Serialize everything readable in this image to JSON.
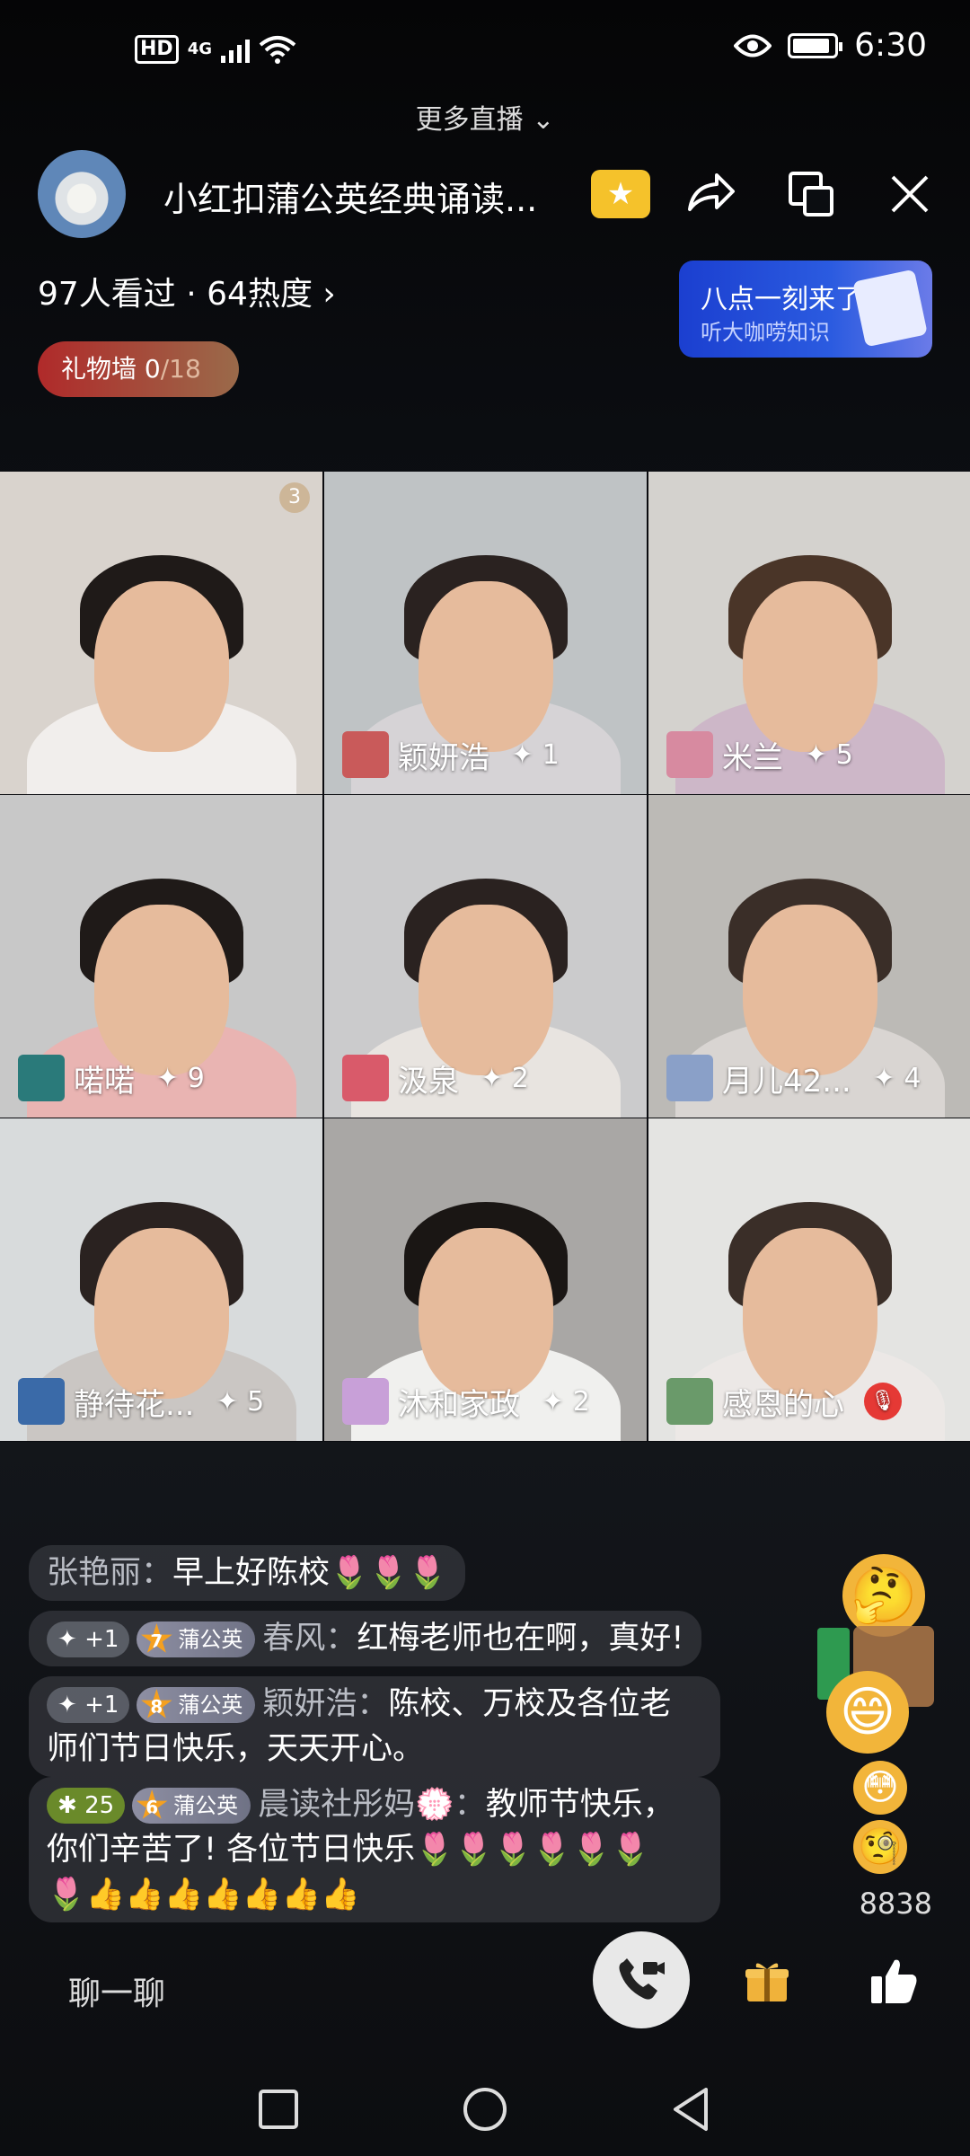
{
  "status_bar": {
    "left": {
      "hd": "HD",
      "network": "4G"
    },
    "time": "6:30"
  },
  "more_live": "更多直播",
  "header": {
    "title": "小红扣蒲公英经典诵读...",
    "icons": [
      "star-badge-icon",
      "share-icon",
      "floating-window-icon",
      "close-icon"
    ]
  },
  "stats": "97人看过 · 64热度",
  "promo": {
    "line1": "八点一刻来了",
    "line2": "听大咖唠知识"
  },
  "gift_wall": {
    "label": "礼物墙 ",
    "count": "0",
    "total": "/18"
  },
  "tiles": [
    {
      "name": "",
      "score": "",
      "count_badge": "3",
      "bg": "#d9d3cd",
      "shirt": "#f1eeec",
      "hair": "#1f1a18"
    },
    {
      "name": "颖妍浩",
      "score": "1",
      "bg": "#bfc3c5",
      "shirt": "#d6d3d6",
      "hair": "#2a2220"
    },
    {
      "name": "米兰",
      "score": "5",
      "bg": "#d4d2ce",
      "shirt": "#cdb7c8",
      "hair": "#4a3528"
    },
    {
      "name": "喏喏",
      "score": "9",
      "bg": "#c8c8c8",
      "shirt": "#e9b4b2",
      "hair": "#1f1a18"
    },
    {
      "name": "汲泉",
      "score": "2",
      "bg": "#cbcbcc",
      "shirt": "#e8e4e0",
      "hair": "#2a2220"
    },
    {
      "name": "月儿42...",
      "score": "4",
      "bg": "#bcbab6",
      "shirt": "#d9d5d2",
      "hair": "#3a2e28"
    },
    {
      "name": "静待花...",
      "score": "5",
      "bg": "#d8dbdc",
      "shirt": "#cac6c3",
      "hair": "#2a2220"
    },
    {
      "name": "沐和家政",
      "score": "2",
      "bg": "#a9a7a5",
      "shirt": "#f0f0ee",
      "hair": "#1a1614"
    },
    {
      "name": "感恩的心",
      "score": "",
      "muted": true,
      "bg": "#e4e4e2",
      "shirt": "#ece8e6",
      "hair": "#3a2e28"
    }
  ],
  "chat": [
    {
      "user": "张艳丽",
      "text": "早上好陈校",
      "flowers": "🌷🌷🌷"
    },
    {
      "plus": "+1",
      "level": "7",
      "club": "蒲公英",
      "user": "春风",
      "text": "红梅老师也在啊，真好!"
    },
    {
      "plus": "+1",
      "level": "8",
      "club": "蒲公英",
      "user": "颖妍浩",
      "text": "陈校、万校及各位老",
      "text2": "师们节日快乐，天天开心。"
    },
    {
      "plus": "25",
      "level": "6",
      "club": "蒲公英",
      "user": "晨读社彤妈💮",
      "text": "教师节快乐，",
      "text2": "你们辛苦了! 各位节日快乐",
      "flowers2": "🌷🌷🌷🌷🌷🌷",
      "flowers3": "🌷",
      "thumbs": "👍👍👍👍👍👍👍"
    }
  ],
  "likes": "8838",
  "bottom": {
    "chat_label": "聊一聊"
  }
}
